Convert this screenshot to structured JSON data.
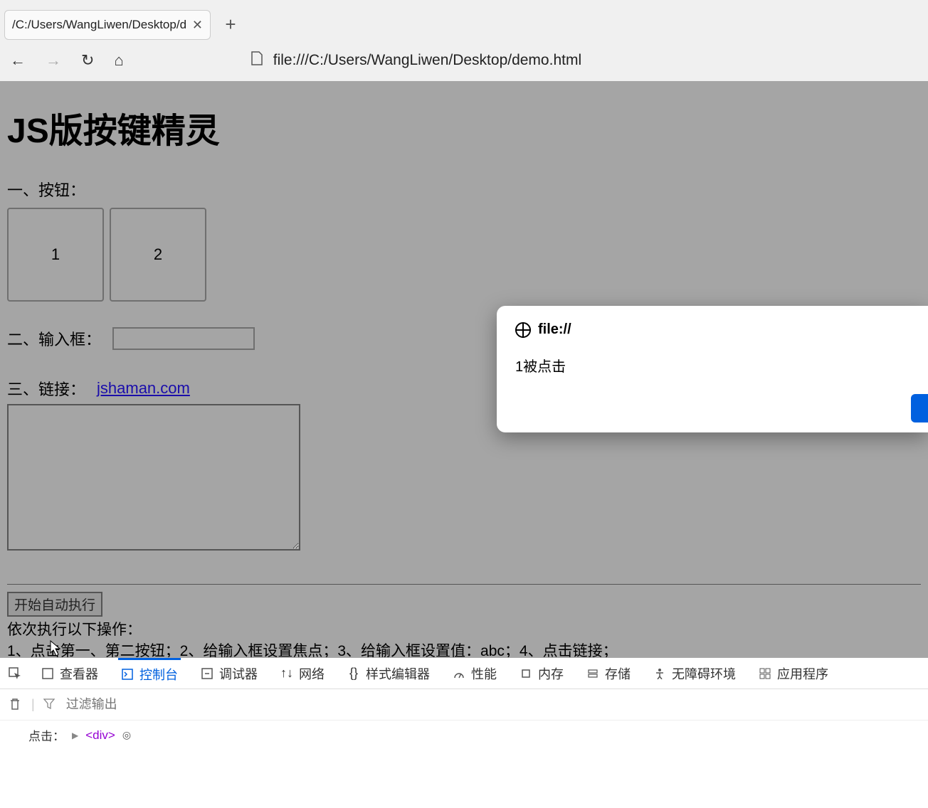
{
  "browser": {
    "tab_title": "/C:/Users/WangLiwen/Desktop/d",
    "url": "file:///C:/Users/WangLiwen/Desktop/demo.html"
  },
  "page": {
    "heading": "JS版按键精灵",
    "section1_label": "一、按钮：",
    "button1": "1",
    "button2": "2",
    "section2_label": "二、输入框：",
    "input_value": "",
    "section3_label": "三、链接：",
    "link_text": "jshaman.com",
    "auto_run_btn": "开始自动执行",
    "ops_title": "依次执行以下操作：",
    "ops_detail": "1、点击第一、第二按钮；2、给输入框设置焦点；3、给输入框设置值：abc；4、点击链接；"
  },
  "alert": {
    "origin": "file://",
    "message": "1被点击"
  },
  "devtools": {
    "tabs": {
      "inspector": "查看器",
      "console": "控制台",
      "debugger": "调试器",
      "network": "网络",
      "style_editor": "样式编辑器",
      "performance": "性能",
      "memory": "内存",
      "storage": "存储",
      "accessibility": "无障碍环境",
      "application": "应用程序"
    },
    "filter_placeholder": "过滤输出",
    "console_line_label": "点击：",
    "console_tag": "<div>"
  }
}
